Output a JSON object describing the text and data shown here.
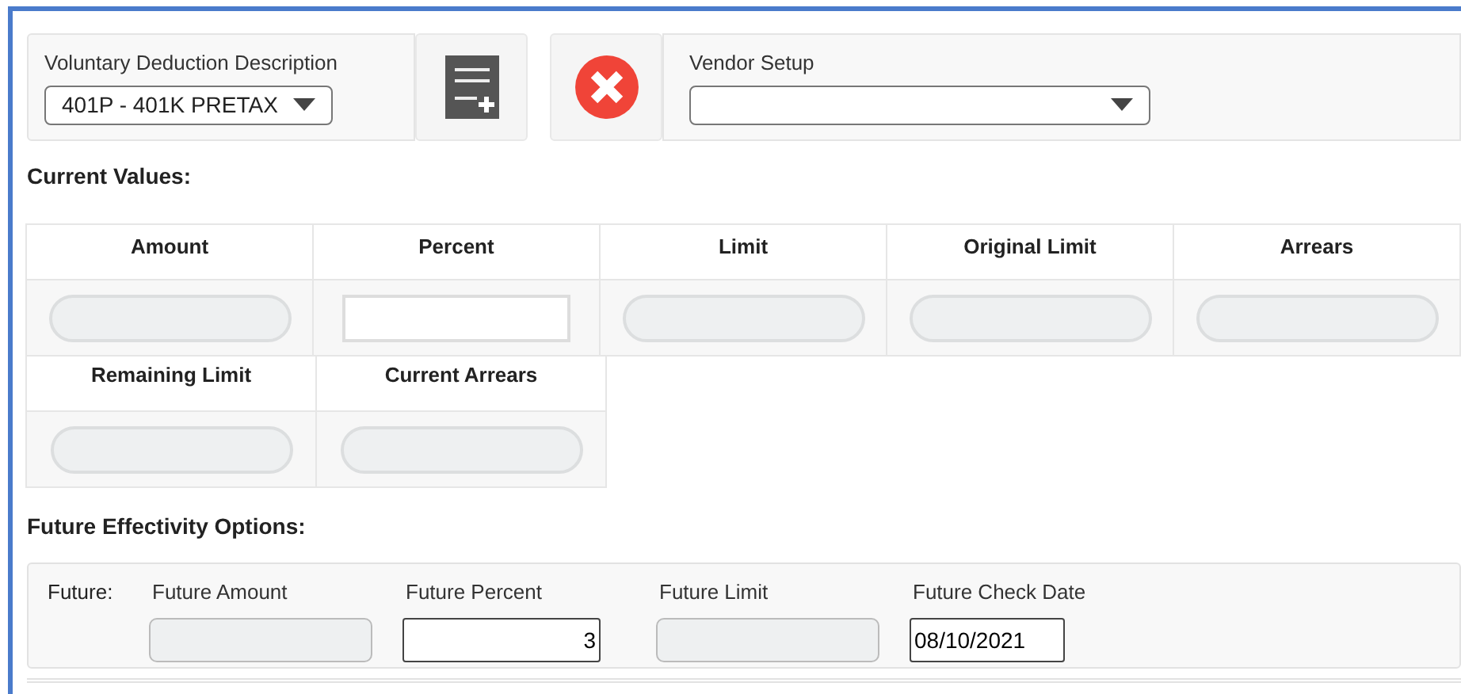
{
  "deduction": {
    "label": "Voluntary Deduction Description",
    "value": "401P - 401K PRETAX"
  },
  "vendor": {
    "label": "Vendor Setup"
  },
  "current": {
    "title": "Current Values:",
    "fields": [
      {
        "label": "Amount",
        "disabled": true
      },
      {
        "label": "Percent",
        "disabled": false
      },
      {
        "label": "Limit",
        "disabled": true
      },
      {
        "label": "Original Limit",
        "disabled": true
      },
      {
        "label": "Arrears",
        "disabled": true
      },
      {
        "label": "Remaining Limit",
        "disabled": true
      },
      {
        "label": "Current Arrears",
        "disabled": true
      }
    ]
  },
  "future": {
    "title": "Future Effectivity Options:",
    "prefix": "Future:",
    "fields": [
      {
        "label": "Future Amount",
        "disabled": true
      },
      {
        "label": "Future Percent",
        "disabled": false,
        "value": "3",
        "kind": "number"
      },
      {
        "label": "Future Limit",
        "disabled": true
      },
      {
        "label": "Future Check Date",
        "disabled": false,
        "value": "08/10/2021",
        "kind": "date"
      }
    ]
  }
}
